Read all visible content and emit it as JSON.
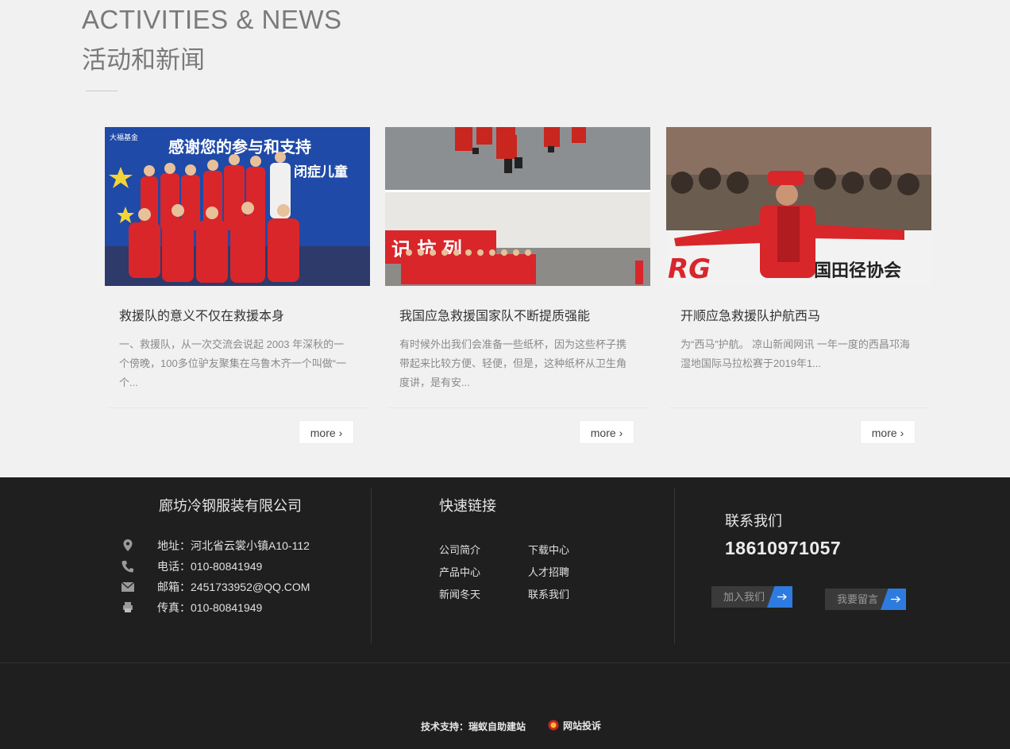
{
  "section": {
    "title_en": "ACTIVITIES & NEWS",
    "title_cn": "活动和新闻"
  },
  "news": [
    {
      "title": "救援队的意义不仅在救援本身",
      "desc": "一、救援队，从一次交流会说起 2003 年深秋的一个傍晚，100多位驴友聚集在乌鲁木齐一个叫做“一个...",
      "more": "more",
      "banner_text": "感谢您的参与和支持",
      "banner_text2": "闭症儿童",
      "logo_text": "大福基金"
    },
    {
      "title": "我国应急救援国家队不断提质强能",
      "desc": "有时候外出我们会准备一些纸杯，因为这些杯子携带起来比较方便、轻便，但是，这种纸杯从卫生角度讲，是有安...",
      "more": "more"
    },
    {
      "title": "开顺应急救援队护航西马",
      "desc": "为“西马”护航。 凉山新闻网讯 一年一度的西昌邛海湿地国际马拉松赛于2019年1...",
      "more": "more",
      "banner_text": "国田径协会",
      "banner_left": "RG"
    }
  ],
  "footer": {
    "company": "廊坊冷钢服装有限公司",
    "contacts": [
      {
        "icon": "location-pin-icon",
        "text": "地址：河北省云裳小镇A10-112"
      },
      {
        "icon": "phone-icon",
        "text": "电话：010-80841949"
      },
      {
        "icon": "mail-icon",
        "text": "邮箱：2451733952@QQ.COM"
      },
      {
        "icon": "printer-icon",
        "text": "传真：010-80841949"
      }
    ],
    "links_title": "快速链接",
    "links": [
      "公司简介",
      "下载中心",
      "产品中心",
      "人才招聘",
      "新闻冬天",
      "联系我们"
    ],
    "contact_title": "联系我们",
    "phone": "18610971057",
    "join_label": "加入我们",
    "message_label": "我要留言",
    "support": "技术支持：瑞蚁自助建站",
    "report": "网站投诉"
  },
  "colors": {
    "accent": "#2e7be0",
    "footer_bg": "#1f1f1f",
    "page_bg": "#f1f1f1"
  }
}
